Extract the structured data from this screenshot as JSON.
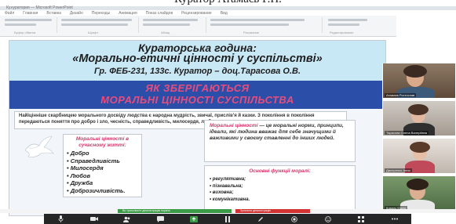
{
  "header_title": "Куратор Атамаєв Р.П.",
  "app": {
    "title": "Ку.куратория — Microsoft PowerPoint"
  },
  "menu": [
    "Файл",
    "Главная",
    "Вставка",
    "Дизайн",
    "Переходы",
    "Анимация",
    "Показ слайдов",
    "Рецензирование",
    "Вид"
  ],
  "ribbon_groups": [
    "Буфер обмена",
    "Шрифт",
    "Абзац",
    "Рисование",
    "Редактирование"
  ],
  "slide": {
    "title1": "Кураторська година:",
    "title2": "«Морально-етичні цінності у суспільстві»",
    "title3": "Гр. ФЕБ-231, 133с. Куратор – доц.Тарасова О.В.",
    "banner1": "ЯК ЗБЕРІГАЮТЬСЯ",
    "banner2": "МОРАЛЬНІ ЦІННОСТІ СУСПІЛЬСТВА",
    "intro": "Найіцінніше скарбницею морального досвіду людства є народна мудрість, звичаї, прислів'я й казки. З покоління в покоління передаються поняття про добро і зло, чесність, справедливість, милосердя, любов.",
    "values_title": "Моральні цінності в сучасному житті:",
    "values": [
      "Добро",
      "Справедливість",
      "Милосердя",
      "Любов",
      "Дружба",
      "Доброзичливість."
    ],
    "definition_term": "Моральні цінності",
    "definition_text": " — це моральні норми, принципи, ідеали, які людина вважає для себе значущими й важливими у своєму ставленні до інших людей.",
    "functions_title": "Основні функції моралі:",
    "functions": [
      "регулятивна;",
      "пізнавальна;",
      "виховна;",
      "комунікативна."
    ]
  },
  "status": {
    "green_text": "Ви транслюєте демонстрацію екрана",
    "red_text": "Зупинити демонстрацію"
  },
  "participants": [
    {
      "name": "Атамаєв Ростислав"
    },
    {
      "name": "Тарасова Олена Валеріївна"
    },
    {
      "name": "Дмитренко Анна"
    },
    {
      "name": "Коваль Марія"
    }
  ],
  "colors": {
    "slide_header_bg": "#c9e8f5",
    "banner_bg": "#2b4fa8",
    "banner_text": "#e84c7d",
    "accent_pink": "#d2386b",
    "toolbar_bg": "#262626"
  }
}
